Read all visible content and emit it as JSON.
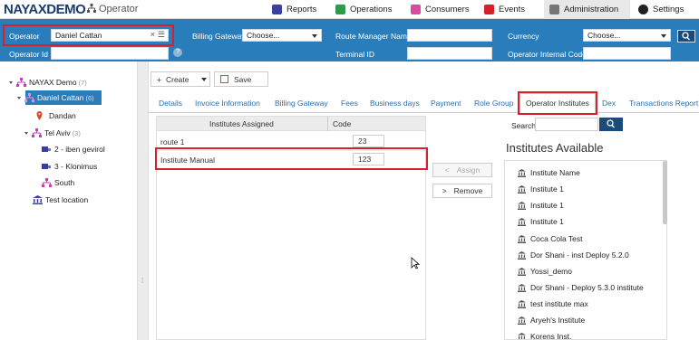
{
  "app": {
    "logo": "NAYAXDEMO",
    "section": "Operator"
  },
  "nav": {
    "reports": "Reports",
    "operations": "Operations",
    "consumers": "Consumers",
    "events": "Events",
    "administration": "Administration",
    "settings": "Settings"
  },
  "filters": {
    "operator_label": "Operator",
    "operator_value": "Daniel Cattan",
    "operator_id_label": "Operator Id",
    "operator_id_value": "",
    "billing_gateway_label": "Billing Gateway",
    "billing_gateway_value": "Choose...",
    "route_manager_label": "Route Manager Name",
    "route_manager_value": "",
    "terminal_id_label": "Terminal ID",
    "terminal_id_value": "",
    "currency_label": "Currency",
    "currency_value": "Choose...",
    "operator_internal_code_label": "Operator Internal Code",
    "operator_internal_code_value": "",
    "help_glyph": "?"
  },
  "tree": [
    {
      "label": "NAYAX Demo",
      "count": "(7)"
    },
    {
      "label": "Daniel Cattan",
      "count": "(6)"
    },
    {
      "label": "Dandan",
      "count": ""
    },
    {
      "label": "Tel Aviv",
      "count": "(3)"
    },
    {
      "label": "2 - iben gevirol",
      "count": ""
    },
    {
      "label": "3 - Klonimus",
      "count": ""
    },
    {
      "label": "South",
      "count": ""
    },
    {
      "label": "Test location",
      "count": ""
    }
  ],
  "toolbar": {
    "create_label": "Create",
    "save_label": "Save"
  },
  "tabs": [
    "Details",
    "Invoice Information",
    "Billing Gateway",
    "Fees",
    "Business days",
    "Payment",
    "Role Group",
    "Operator Institutes",
    "Dex",
    "Transactions Report"
  ],
  "assigned": {
    "header_institute": "Institutes Assigned",
    "header_code": "Code",
    "rows": [
      {
        "name": "route 1",
        "code": "23"
      },
      {
        "name": "Institute Manual",
        "code": "123"
      }
    ]
  },
  "actions": {
    "assign_label": "Assign",
    "remove_label": "Remove",
    "assign_glyph": "<",
    "remove_glyph": ">"
  },
  "available": {
    "search_label": "Search",
    "search_value": "",
    "title": "Institutes Available",
    "items": [
      "Institute Name",
      "Institute 1",
      "Institute 1",
      "Institute 1",
      "Coca Cola Test",
      "Dor Shani - inst Deploy 5.2.0",
      "Yossi_demo",
      "Dor Shani - Deploy 5.3.0 institute",
      "test institute max",
      "Aryeh's Institute",
      "Korens Inst."
    ]
  },
  "colors": {
    "filter_bar": "#2a7dbb",
    "highlight": "#d9202a",
    "selected_node": "#2a7dbb",
    "dark_button": "#1a4b7a"
  }
}
